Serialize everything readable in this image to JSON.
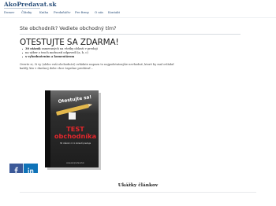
{
  "site": {
    "logo": "AkoPredavat.sk"
  },
  "nav": {
    "items": [
      {
        "label": "Domov"
      },
      {
        "label": "Články"
      },
      {
        "label": "Kniha"
      },
      {
        "label": "Predaňáčiv"
      },
      {
        "label": "Pre firmy"
      },
      {
        "label": "O nás"
      },
      {
        "label": "Kontakt"
      }
    ]
  },
  "main": {
    "question": "Ste obchodník? Vediete obchodný tím?",
    "headline": "OTESTUJTE SA ZDARMA!",
    "bullets": [
      {
        "bold": "30 otázok",
        "text": " zameraných na všetky oblasti v predaji"
      },
      {
        "bold": "",
        "text": "na výber z troch možností odpovedí (a, b, c)"
      },
      {
        "bold": "",
        "text": "s vyhodnotením a komentárom"
      }
    ],
    "paragraph": [
      "Overte si, či vy (alebo vaši obchodníci) ovládate napozn to najpodstatnejšie nevhodné, ktoré by mal ovládať",
      "každý, kto v dnešnej dobe chce úspešne predávať…"
    ]
  },
  "book": {
    "cover_title": "Otestujte sa!",
    "test_word": "TEST",
    "subject": "obchodníka",
    "small_line": "30 otázok z 11 oblastí predaja",
    "bottom_line": "www.akopredavat.sk"
  },
  "social": {
    "facebook_icon": "facebook-icon",
    "linkedin_icon": "linkedin-icon",
    "colors": {
      "facebook": "#3b5998",
      "linkedin": "#0f73b8"
    }
  },
  "examples": {
    "title": "Ukážky článkov"
  }
}
